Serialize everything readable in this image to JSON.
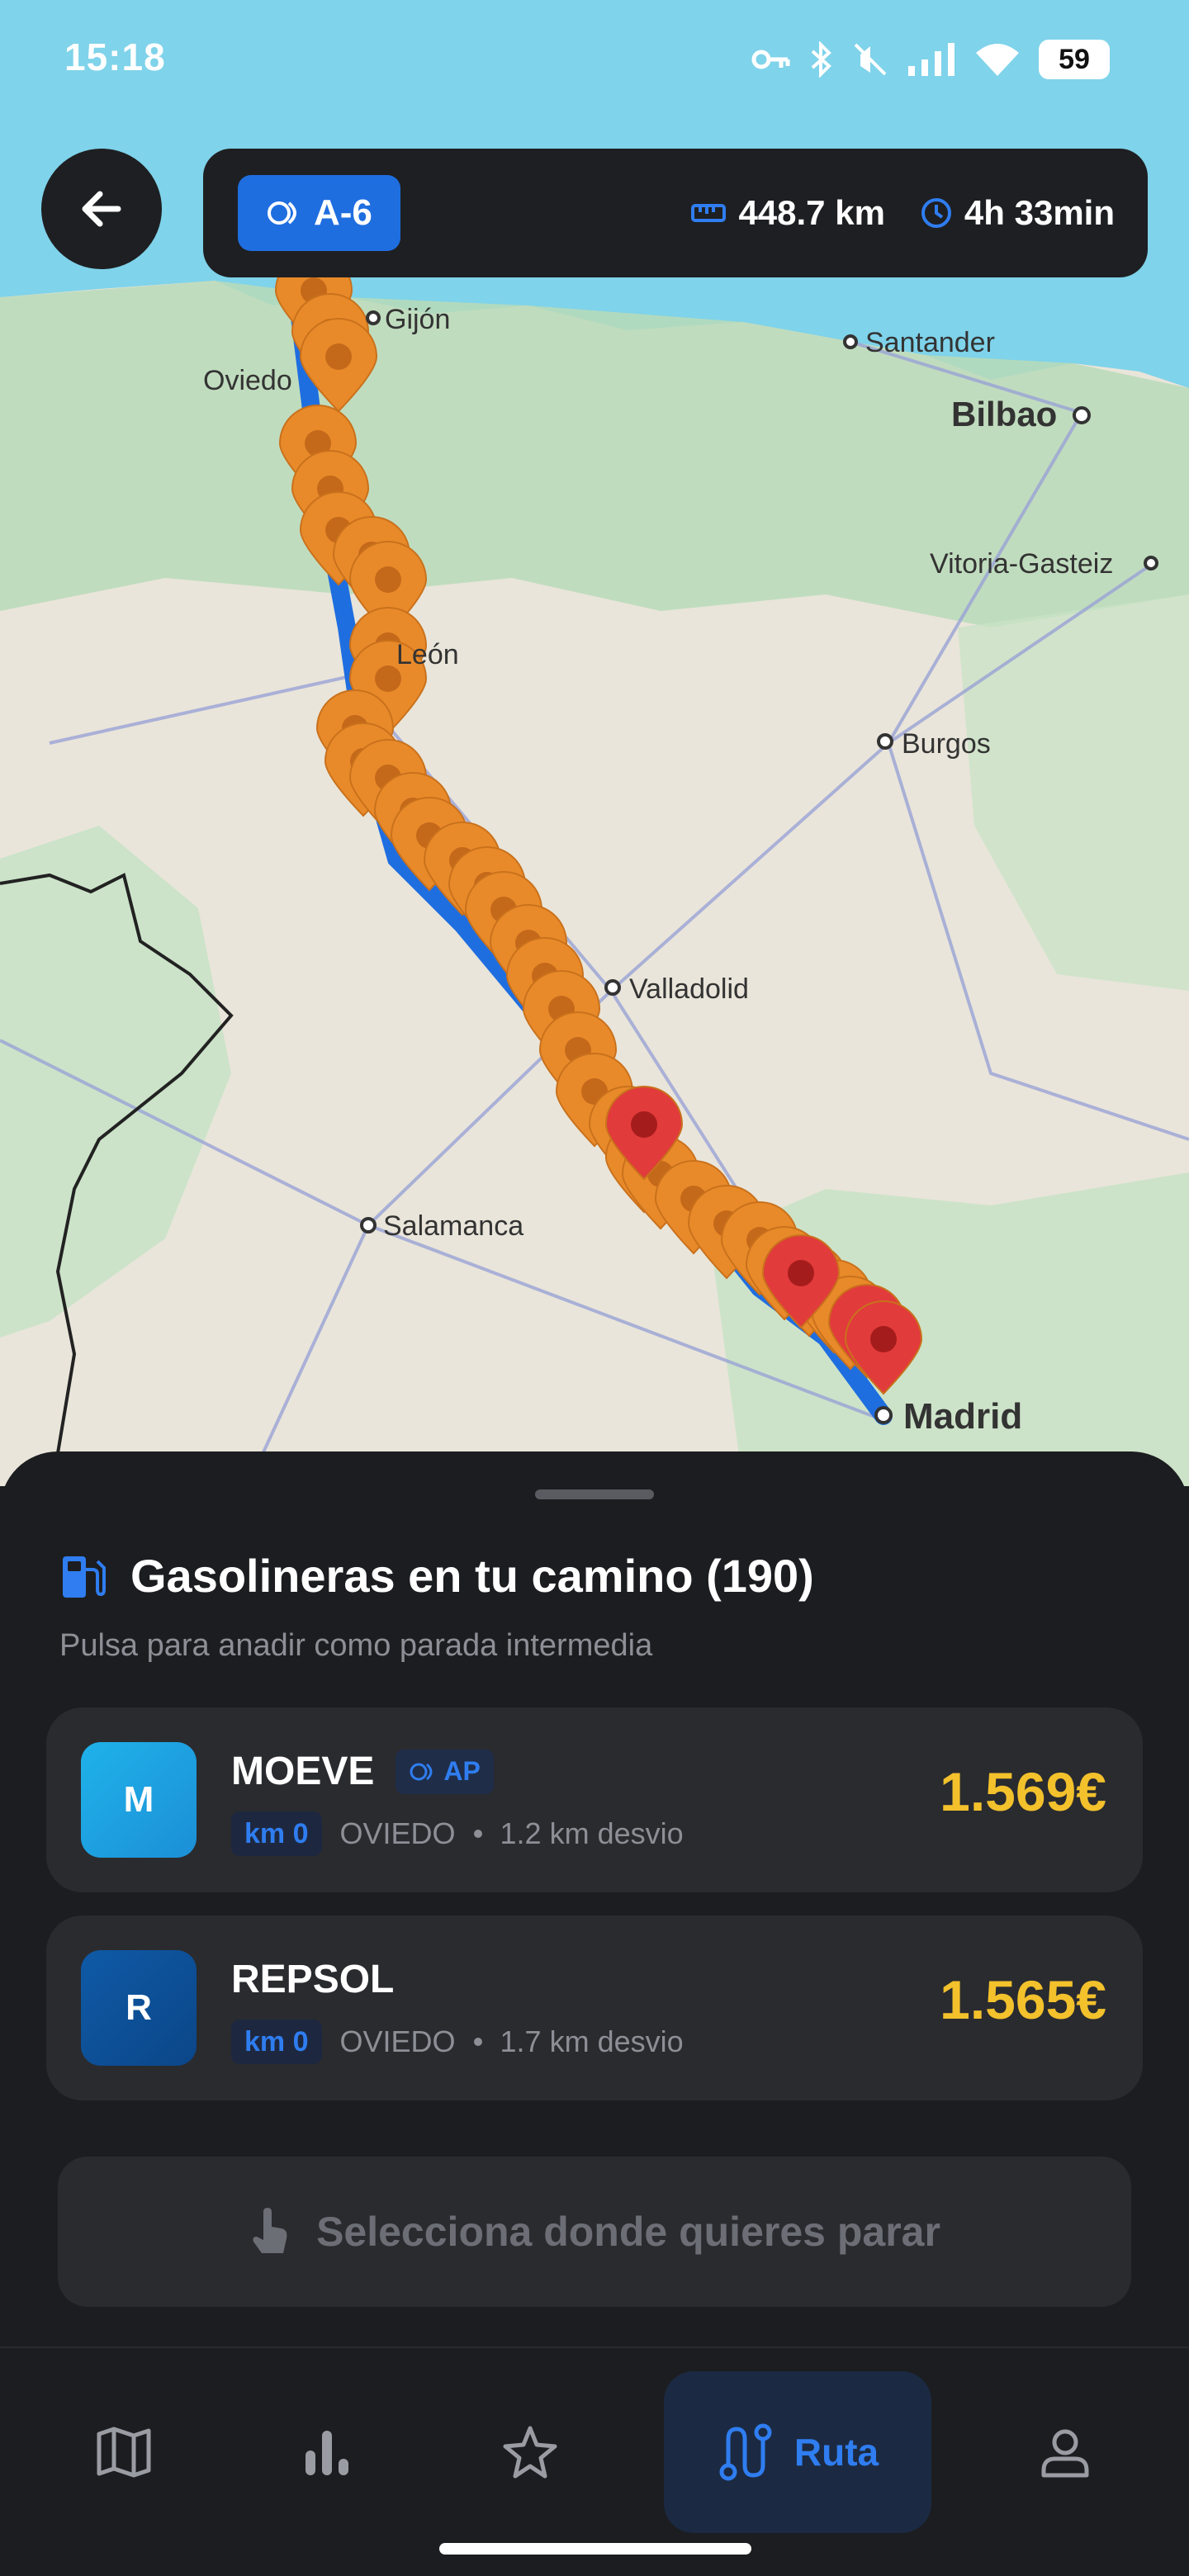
{
  "status_bar": {
    "time": "15:18",
    "battery": "59"
  },
  "route": {
    "road": "A-6",
    "distance": "448.7 km",
    "duration": "4h 33min"
  },
  "map": {
    "cities": [
      {
        "name": "Gijón"
      },
      {
        "name": "Oviedo"
      },
      {
        "name": "Santander"
      },
      {
        "name": "Bilbao"
      },
      {
        "name": "Vitoria-Gasteiz"
      },
      {
        "name": "León"
      },
      {
        "name": "Burgos"
      },
      {
        "name": "Valladolid"
      },
      {
        "name": "Salamanca"
      },
      {
        "name": "Madrid"
      }
    ],
    "colors": {
      "route": "#1f6ee0",
      "station_marker": "#e98a2a",
      "highlight_marker": "#e23b3b"
    }
  },
  "sheet": {
    "title": "Gasolineras en tu camino (190)",
    "subtitle": "Pulsa para anadir como parada intermedia",
    "stations": [
      {
        "initial": "M",
        "name": "MOEVE",
        "badge": "AP",
        "km": "km 0",
        "city": "OVIEDO",
        "detour": "1.2 km desvio",
        "price": "1.569€",
        "logo_color": "#1fb2ea"
      },
      {
        "initial": "R",
        "name": "REPSOL",
        "badge": "",
        "km": "km 0",
        "city": "OVIEDO",
        "detour": "1.7 km desvio",
        "price": "1.565€",
        "logo_color": "#0f5aa6"
      }
    ],
    "select_button": "Selecciona donde quieres parar"
  },
  "nav": {
    "items": [
      {
        "icon": "map-icon"
      },
      {
        "icon": "stats-icon"
      },
      {
        "icon": "star-icon"
      },
      {
        "icon": "route-icon",
        "label": "Ruta",
        "active": true
      },
      {
        "icon": "profile-icon"
      }
    ]
  }
}
